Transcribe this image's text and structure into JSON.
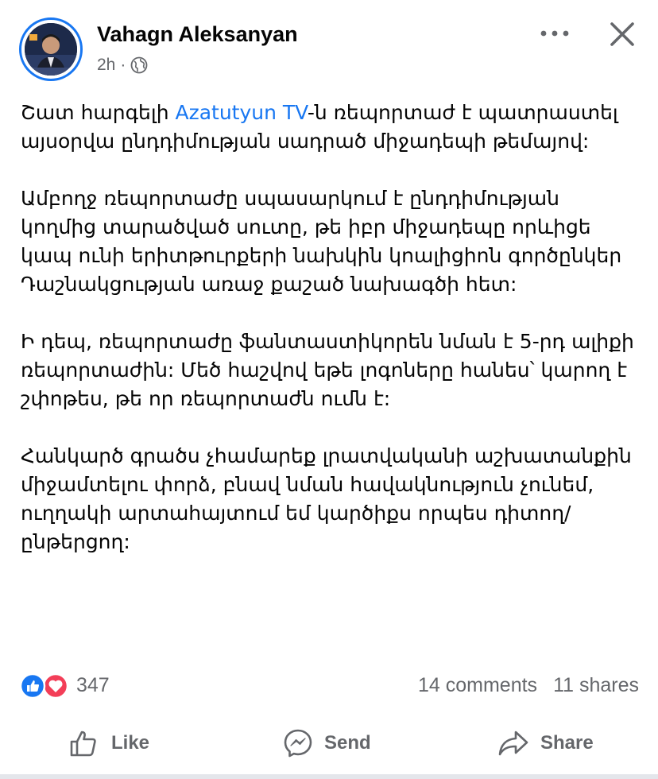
{
  "post": {
    "author": "Vahagn Aleksanyan",
    "time": "2h",
    "audience_icon": "globe-icon",
    "body": {
      "p1_pre": "Շատ հարգելի ",
      "p1_link": "Azatutyun TV",
      "p1_post": "-ն ռեպորտաժ է պատրաստել այսօրվա ընդդիմության սադրած միջադեպի թեմայով:",
      "p2": "Ամբողջ ռեպորտաժը սպասարկում է ընդդիմության կողմից տարածված սուտը, թե իբր միջադեպը որևիցե կապ ունի երիտթուրքերի նախկին կոալիցիոն գործընկեր Դաշնակցության առաջ քաշած նախագծի հետ:",
      "p3": "Ի դեպ, ռեպորտաժը ֆանտաստիկորեն նման է 5-րդ ալիքի ռեպորտաժին: Մեծ հաշվով եթե լոգոները հանես՝ կարող է շփոթես, թե որ ռեպորտաժն ումն է:",
      "p4": "Հանկարծ գրածս չհամարեք լրատվականի աշխատանքին միջամտելու փորձ, բնավ նման հավակնություն չունեմ, ուղղակի արտահայտում եմ կարծիքս որպես դիտող/ընթերցող:"
    }
  },
  "engagement": {
    "reaction_count": "347",
    "comments": "14 comments",
    "shares": "11 shares"
  },
  "actions": {
    "like": "Like",
    "send": "Send",
    "share": "Share"
  },
  "colors": {
    "accent": "#1877f2",
    "secondary_text": "#65676b",
    "love": "#f33e58"
  }
}
